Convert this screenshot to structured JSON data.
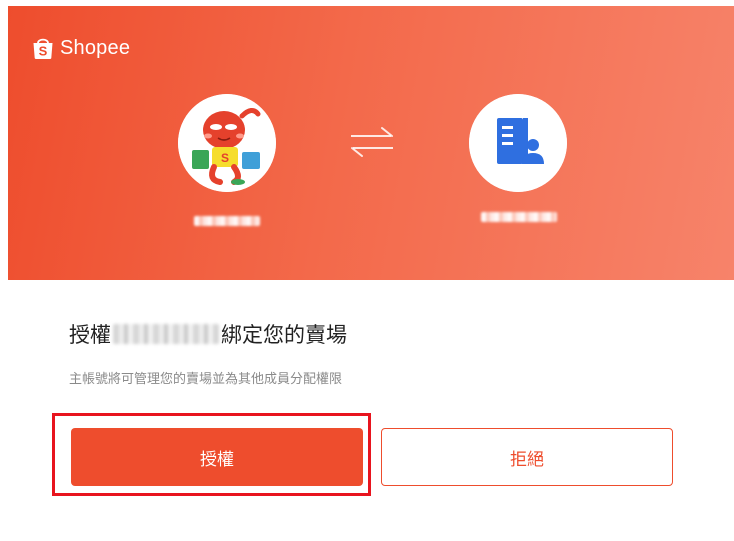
{
  "brand": {
    "name": "Shopee",
    "accent_color": "#ee4d2d"
  },
  "banner": {
    "user_avatar": "mascot-avatar",
    "swap_icon": "swap-arrows-icon",
    "partner_avatar": "building-user-icon"
  },
  "auth": {
    "title_prefix": "授權",
    "title_suffix": "綁定您的賣場",
    "description": "主帳號將可管理您的賣場並為其他成員分配權限"
  },
  "buttons": {
    "authorize_label": "授權",
    "reject_label": "拒絕"
  }
}
